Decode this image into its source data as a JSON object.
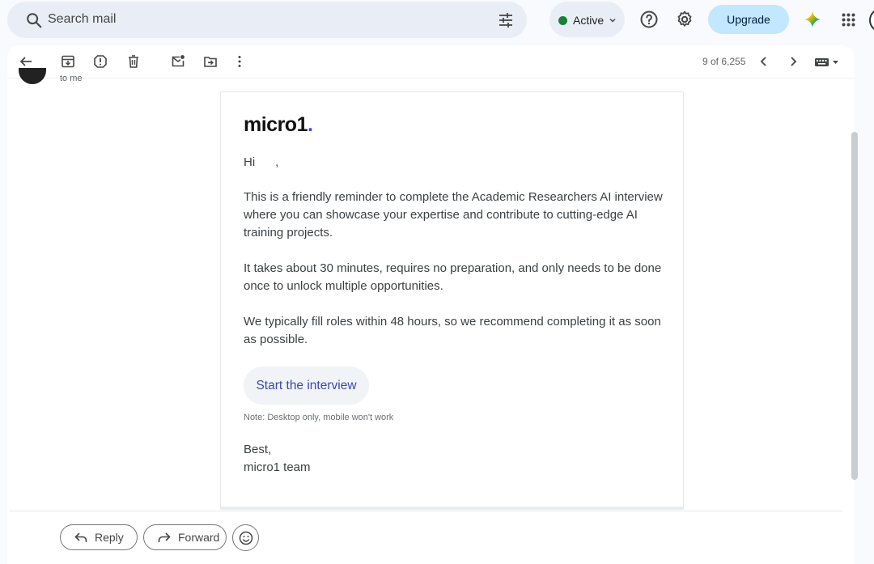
{
  "search": {
    "placeholder": "Search mail"
  },
  "status": {
    "label": "Active",
    "color": "#188038"
  },
  "header": {
    "upgrade_label": "Upgrade"
  },
  "toolbar": {
    "pager": "9 of 6,255"
  },
  "message": {
    "to_label": "to me",
    "logo_text": "micro1",
    "logo_dot": ".",
    "greeting": "Hi      ,",
    "paragraphs": [
      "This is a friendly reminder to complete the Academic Researchers AI interview where you can showcase your expertise and contribute to cutting-edge AI training projects.",
      "It takes about 30 minutes, requires no preparation, and only needs to be done once to unlock multiple opportunities.",
      "We typically fill roles within 48 hours, so we recommend completing it as soon as possible."
    ],
    "cta_label": "Start the interview",
    "note": "Note: Desktop only, mobile won't work",
    "signoff_line1": "Best,",
    "signoff_line2": "micro1 team"
  },
  "actions": {
    "reply_label": "Reply",
    "forward_label": "Forward"
  },
  "colors": {
    "accent": "#c2e7ff",
    "link": "#3949ab",
    "logo_dot": "#3b4bd8"
  }
}
